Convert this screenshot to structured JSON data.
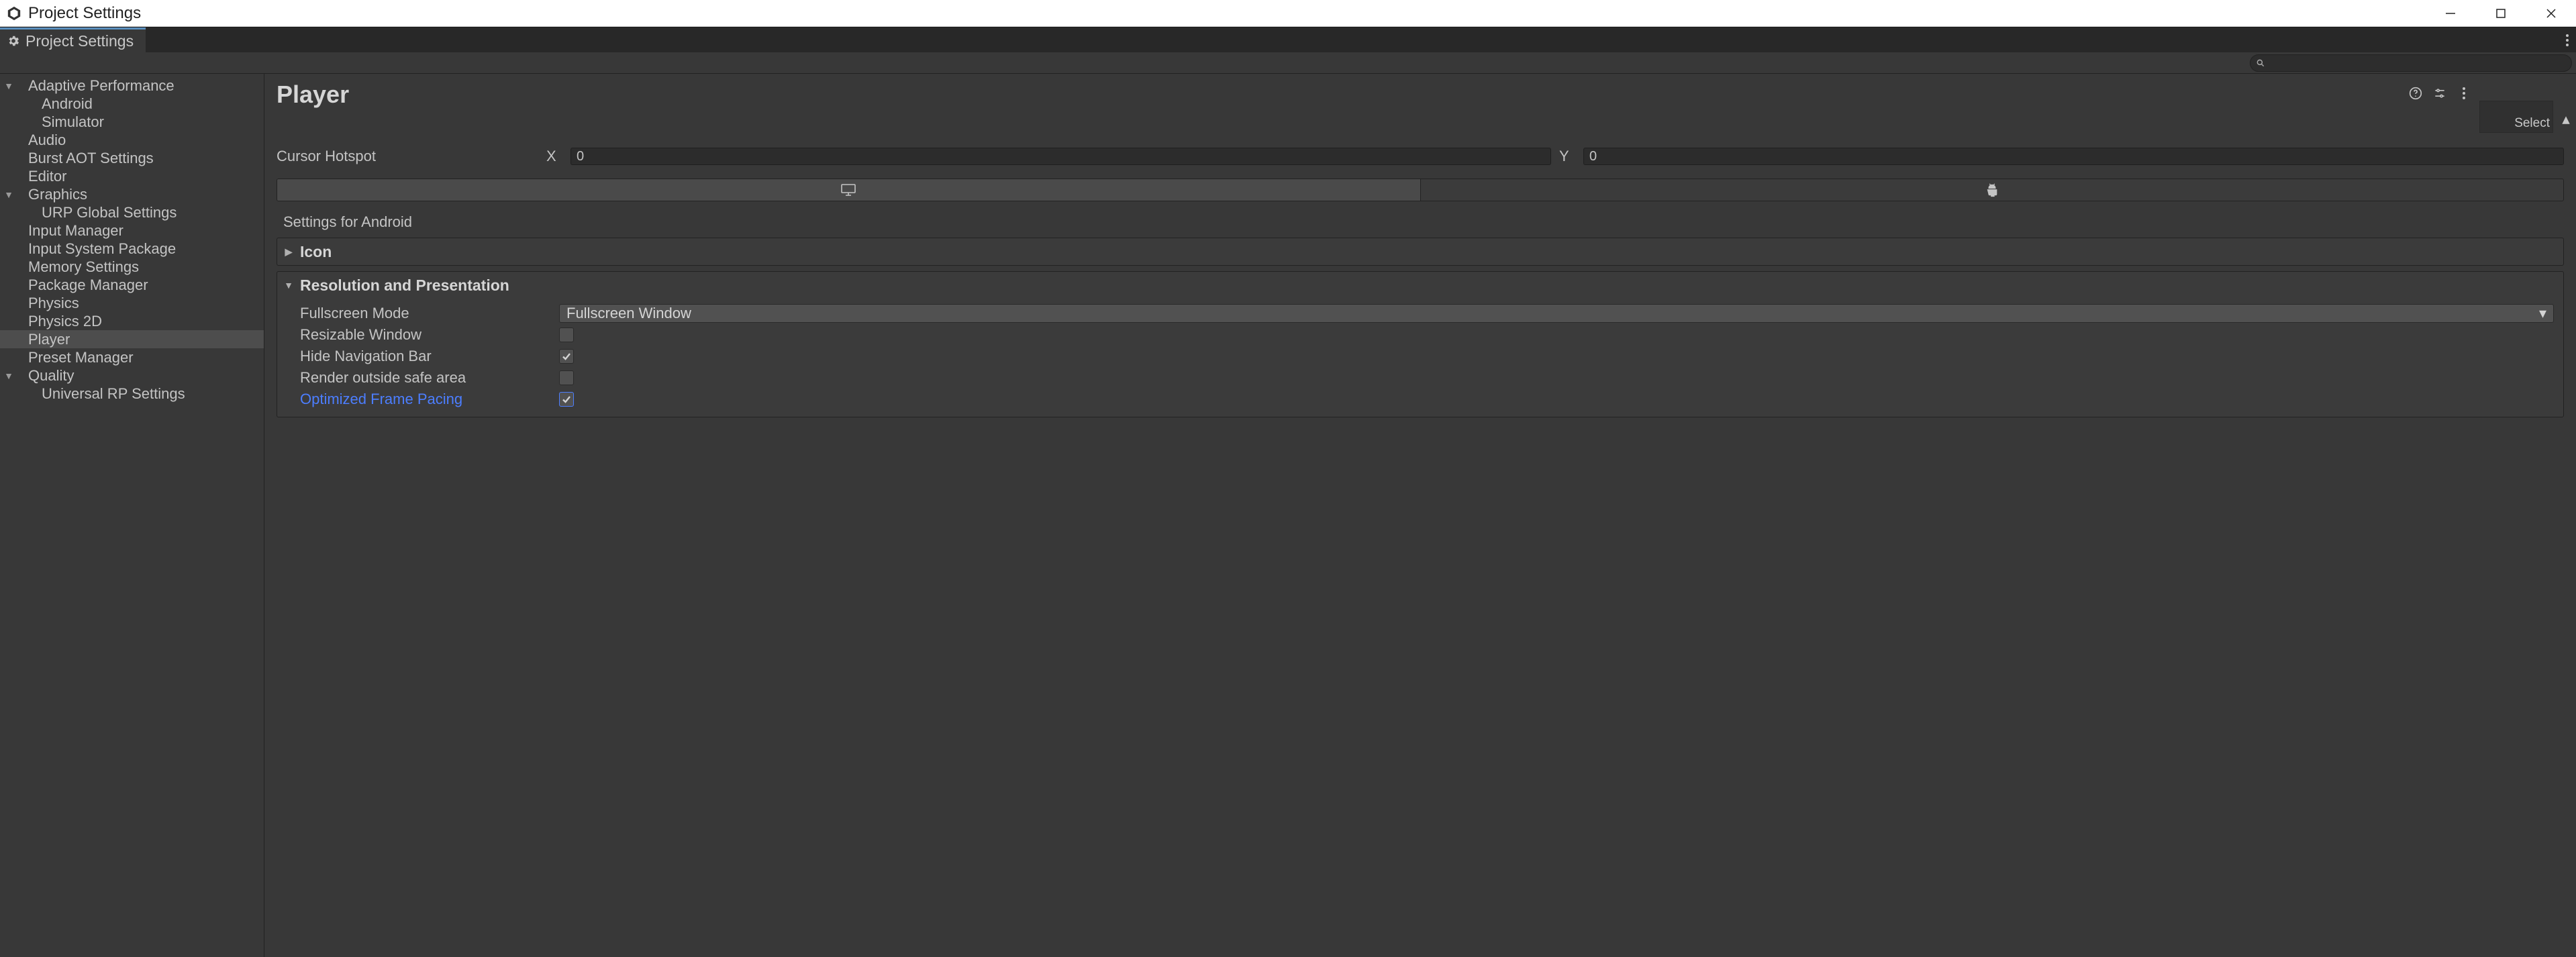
{
  "window": {
    "title": "Project Settings"
  },
  "tab": {
    "label": "Project Settings"
  },
  "search": {
    "value": ""
  },
  "sidebar": {
    "items": [
      {
        "label": "Adaptive Performance",
        "indent": 1,
        "expandable": true,
        "expanded": true
      },
      {
        "label": "Android",
        "indent": 2
      },
      {
        "label": "Simulator",
        "indent": 2
      },
      {
        "label": "Audio",
        "indent": 1
      },
      {
        "label": "Burst AOT Settings",
        "indent": 1
      },
      {
        "label": "Editor",
        "indent": 1
      },
      {
        "label": "Graphics",
        "indent": 1,
        "expandable": true,
        "expanded": true
      },
      {
        "label": "URP Global Settings",
        "indent": 2
      },
      {
        "label": "Input Manager",
        "indent": 1
      },
      {
        "label": "Input System Package",
        "indent": 1
      },
      {
        "label": "Memory Settings",
        "indent": 1
      },
      {
        "label": "Package Manager",
        "indent": 1
      },
      {
        "label": "Physics",
        "indent": 1
      },
      {
        "label": "Physics 2D",
        "indent": 1
      },
      {
        "label": "Player",
        "indent": 1,
        "selected": true
      },
      {
        "label": "Preset Manager",
        "indent": 1
      },
      {
        "label": "Quality",
        "indent": 1,
        "expandable": true,
        "expanded": true
      },
      {
        "label": "Universal RP Settings",
        "indent": 2
      }
    ]
  },
  "page": {
    "title": "Player",
    "select_label": "Select",
    "cursor_hotspot": {
      "label": "Cursor Hotspot",
      "x_label": "X",
      "y_label": "Y",
      "x": "0",
      "y": "0"
    },
    "platforms": {
      "active": "android"
    },
    "android_section_title": "Settings for Android",
    "sections": {
      "icon": {
        "title": "Icon",
        "expanded": false
      },
      "resolution": {
        "title": "Resolution and Presentation",
        "expanded": true,
        "fullscreen_mode": {
          "label": "Fullscreen Mode",
          "value": "Fullscreen Window"
        },
        "resizable_window": {
          "label": "Resizable Window",
          "value": false
        },
        "hide_nav_bar": {
          "label": "Hide Navigation Bar",
          "value": true
        },
        "render_outside_safe_area": {
          "label": "Render outside safe area",
          "value": false
        },
        "optimized_frame_pacing": {
          "label": "Optimized Frame Pacing",
          "value": true,
          "highlight": true
        }
      }
    }
  }
}
